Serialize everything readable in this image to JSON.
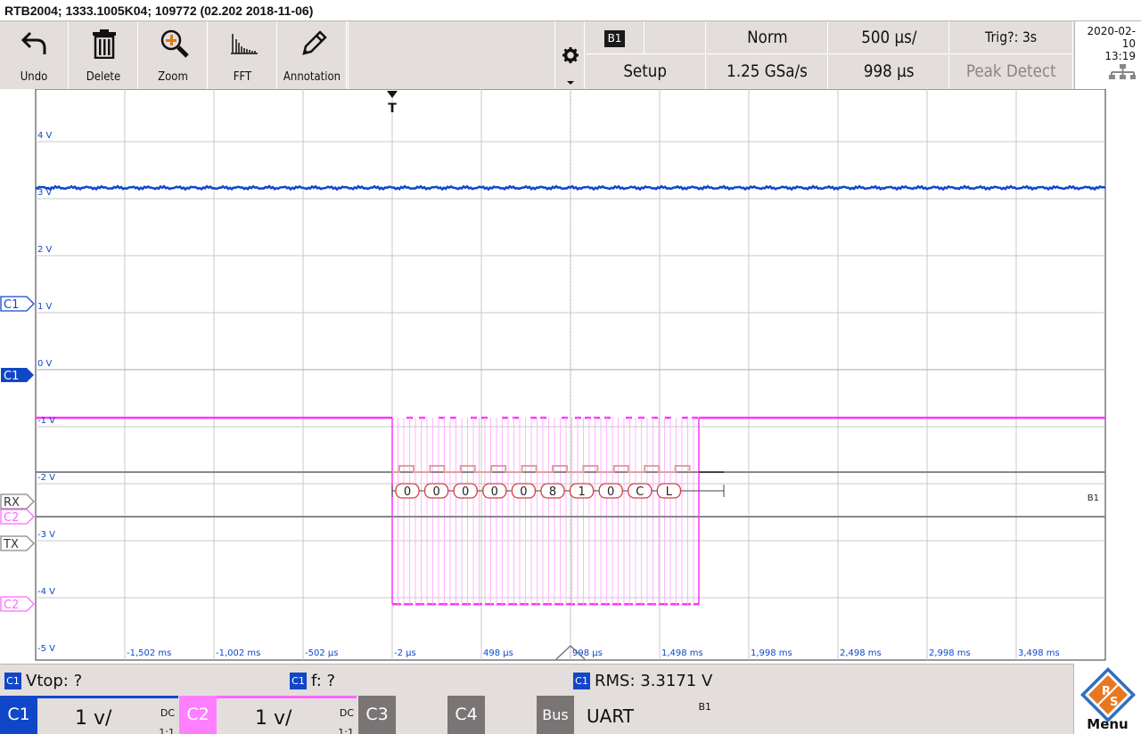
{
  "window": {
    "title": "RTB2004; 1333.1005K04; 109772 (02.202 2018-11-06)"
  },
  "toolbar": {
    "undo": "Undo",
    "delete": "Delete",
    "zoom": "Zoom",
    "fft": "FFT",
    "annotation": "Annotation"
  },
  "settings": {
    "bus_badge": "B1",
    "setup": "Setup",
    "trigger_mode": "Norm",
    "sample_rate": "1.25 GSa/s",
    "timebase": "500 µs/",
    "position": "998 µs",
    "trig_status": "Trig?: 3s",
    "acq_mode": "Peak Detect",
    "date": "2020-02-10",
    "time": "13:19"
  },
  "grid": {
    "volt_labels": [
      "4 V",
      "3 V",
      "2 V",
      "1 V",
      "0 V",
      "-1 V",
      "-2 V",
      "-3 V",
      "-4 V",
      "-5 V"
    ],
    "time_labels": [
      "-1,502 ms",
      "-1,002 ms",
      "-502 µs",
      "-2 µs",
      "498 µs",
      "998 µs",
      "1,498 ms",
      "1,998 ms",
      "2,498 ms",
      "2,998 ms",
      "3,498 ms"
    ],
    "trigger_marker": "T",
    "bus_label": "B1"
  },
  "markers": {
    "c1_trig": "C1",
    "c1": "C1",
    "rx": "RX",
    "c2_trig": "C2",
    "tx": "TX",
    "c2": "C2"
  },
  "decode": {
    "bytes": [
      "0",
      "0",
      "0",
      "0",
      "0",
      "8",
      "1",
      "0",
      "C",
      "L"
    ]
  },
  "measurements": [
    {
      "source": "C1",
      "label": "Vtop: ?"
    },
    {
      "source": "C1",
      "label": "f: ?"
    },
    {
      "source": "C1",
      "label": "RMS: 3.3171 V"
    }
  ],
  "channels": {
    "c1": {
      "name": "C1",
      "scale": "1 v/",
      "coupling": "DC",
      "probe": "1:1"
    },
    "c2": {
      "name": "C2",
      "scale": "1 v/",
      "coupling": "DC",
      "probe": "1:1"
    },
    "c3": {
      "name": "C3"
    },
    "c4": {
      "name": "C4"
    },
    "bus": {
      "name": "Bus",
      "protocol": "UART",
      "id": "B1"
    }
  },
  "menu": {
    "label": "Menu",
    "logo_text": "RS"
  },
  "colors": {
    "c1": "#1047c9",
    "c2": "#ff33ff",
    "bus": "#e0a0a0",
    "grid": "#c8c8c8"
  }
}
